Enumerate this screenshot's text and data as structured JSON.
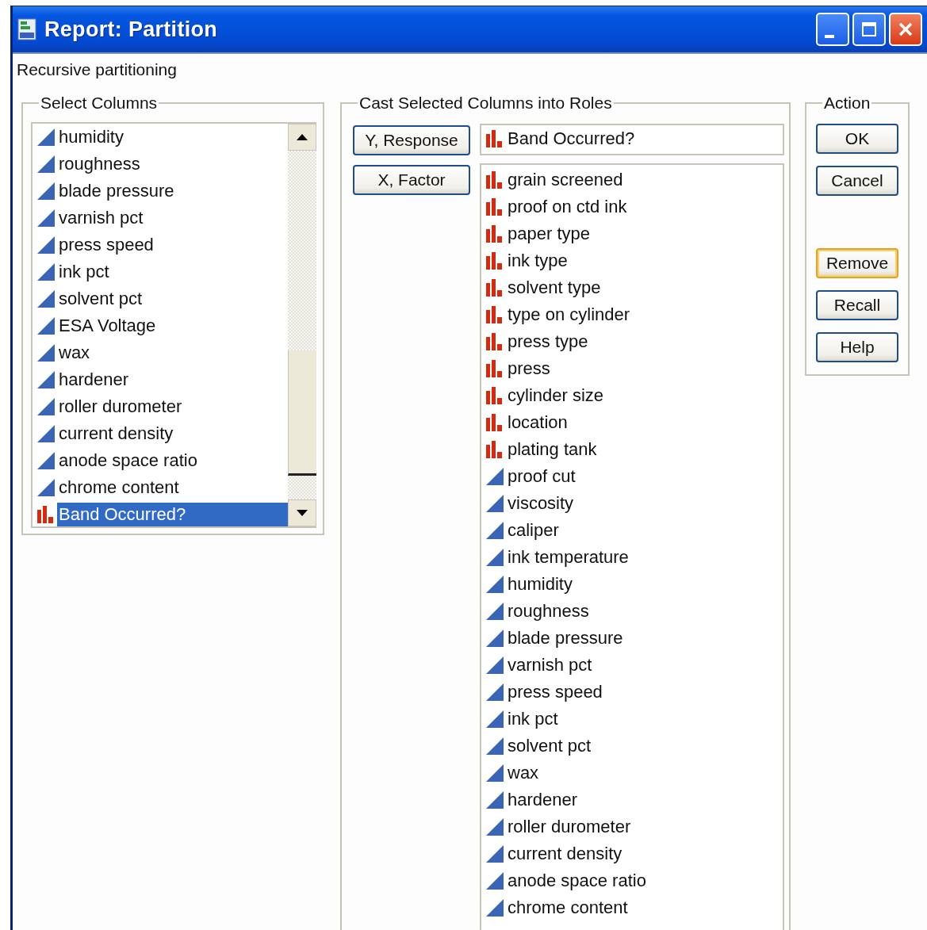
{
  "window": {
    "title": "Report: Partition"
  },
  "description": "Recursive partitioning",
  "select_columns": {
    "title": "Select Columns",
    "items": [
      {
        "name": "humidity",
        "kind": "continuous",
        "selected": false
      },
      {
        "name": "roughness",
        "kind": "continuous",
        "selected": false
      },
      {
        "name": "blade pressure",
        "kind": "continuous",
        "selected": false
      },
      {
        "name": "varnish pct",
        "kind": "continuous",
        "selected": false
      },
      {
        "name": "press speed",
        "kind": "continuous",
        "selected": false
      },
      {
        "name": "ink pct",
        "kind": "continuous",
        "selected": false
      },
      {
        "name": "solvent pct",
        "kind": "continuous",
        "selected": false
      },
      {
        "name": "ESA Voltage",
        "kind": "continuous",
        "selected": false
      },
      {
        "name": "wax",
        "kind": "continuous",
        "selected": false
      },
      {
        "name": "hardener",
        "kind": "continuous",
        "selected": false
      },
      {
        "name": "roller durometer",
        "kind": "continuous",
        "selected": false
      },
      {
        "name": "current density",
        "kind": "continuous",
        "selected": false
      },
      {
        "name": "anode space ratio",
        "kind": "continuous",
        "selected": false
      },
      {
        "name": "chrome content",
        "kind": "continuous",
        "selected": false
      },
      {
        "name": "Band Occurred?",
        "kind": "nominal",
        "selected": true
      }
    ]
  },
  "cast_roles": {
    "title": "Cast Selected Columns into Roles",
    "response": {
      "button": "Y, Response",
      "items": [
        {
          "name": "Band Occurred?",
          "kind": "nominal"
        }
      ]
    },
    "factor": {
      "button": "X, Factor",
      "items": [
        {
          "name": "grain screened",
          "kind": "nominal"
        },
        {
          "name": "proof on ctd ink",
          "kind": "nominal"
        },
        {
          "name": "paper type",
          "kind": "nominal"
        },
        {
          "name": "ink type",
          "kind": "nominal"
        },
        {
          "name": "solvent type",
          "kind": "nominal"
        },
        {
          "name": "type on cylinder",
          "kind": "nominal"
        },
        {
          "name": "press type",
          "kind": "nominal"
        },
        {
          "name": "press",
          "kind": "nominal"
        },
        {
          "name": "cylinder size",
          "kind": "nominal"
        },
        {
          "name": "location",
          "kind": "nominal"
        },
        {
          "name": "plating tank",
          "kind": "nominal"
        },
        {
          "name": "proof cut",
          "kind": "continuous"
        },
        {
          "name": "viscosity",
          "kind": "continuous"
        },
        {
          "name": "caliper",
          "kind": "continuous"
        },
        {
          "name": "ink temperature",
          "kind": "continuous"
        },
        {
          "name": "humidity",
          "kind": "continuous"
        },
        {
          "name": "roughness",
          "kind": "continuous"
        },
        {
          "name": "blade pressure",
          "kind": "continuous"
        },
        {
          "name": "varnish pct",
          "kind": "continuous"
        },
        {
          "name": "press speed",
          "kind": "continuous"
        },
        {
          "name": "ink pct",
          "kind": "continuous"
        },
        {
          "name": "solvent pct",
          "kind": "continuous"
        },
        {
          "name": "wax",
          "kind": "continuous"
        },
        {
          "name": "hardener",
          "kind": "continuous"
        },
        {
          "name": "roller durometer",
          "kind": "continuous"
        },
        {
          "name": "current density",
          "kind": "continuous"
        },
        {
          "name": "anode space ratio",
          "kind": "continuous"
        },
        {
          "name": "chrome content",
          "kind": "continuous"
        }
      ]
    }
  },
  "action": {
    "title": "Action",
    "buttons": [
      {
        "label": "OK",
        "focused": false,
        "gap_before": false
      },
      {
        "label": "Cancel",
        "focused": false,
        "gap_before": false
      },
      {
        "label": "Remove",
        "focused": true,
        "gap_before": true
      },
      {
        "label": "Recall",
        "focused": false,
        "gap_before": false
      },
      {
        "label": "Help",
        "focused": false,
        "gap_before": false
      }
    ]
  }
}
